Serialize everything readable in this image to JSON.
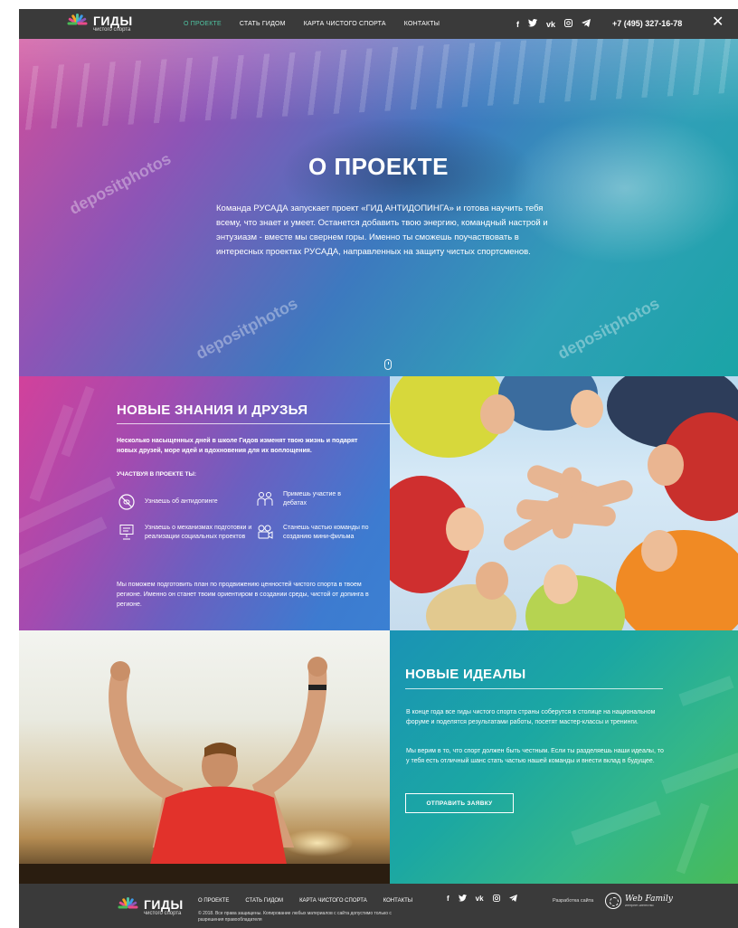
{
  "header": {
    "logo_title": "ГИДЫ",
    "logo_sub": "чистого спорта",
    "nav": [
      "О ПРОЕКТЕ",
      "СТАТЬ ГИДОМ",
      "КАРТА ЧИСТОГО СПОРТА",
      "КОНТАКТЫ"
    ],
    "social_icons": [
      "facebook-icon",
      "twitter-icon",
      "vk-icon",
      "instagram-icon",
      "telegram-icon"
    ],
    "phone": "+7 (495) 327-16-78",
    "close_glyph": "✕",
    "active_color": "#4fc3a1"
  },
  "hero": {
    "title": "О ПРОЕКТЕ",
    "text": "Команда РУСАДА запускает проект «ГИД АНТИДОПИНГА» и готова научить тебя всему, что знает и умеет. Останется добавить твою энергию, командный настрой и энтузиазм - вместе мы свернем горы. Именно ты сможешь поучаствовать в интересных проектах РУСАДА, направленных на защиту чистых спортсменов.",
    "watermark": "depositphotos"
  },
  "section_knowledge": {
    "title": "НОВЫЕ ЗНАНИЯ И ДРУЗЬЯ",
    "lead": "Несколько насыщенных дней в школе Гидов изменят твою жизнь и подарят новых друзей, море идей и вдохновения для их воплощения.",
    "subheading": "УЧАСТВУЯ В ПРОЕКТЕ ТЫ:",
    "features": [
      {
        "icon": "no-drugs-icon",
        "text": "Узнаешь об антидопинге"
      },
      {
        "icon": "debate-icon",
        "text": "Примешь участие в дебатах"
      },
      {
        "icon": "presentation-icon",
        "text": "Узнаешь о механизмах подготовки и реализации социальных проектов"
      },
      {
        "icon": "film-team-icon",
        "text": "Станешь частью команды по созданию мини-фильма"
      }
    ],
    "footer_text": "Мы поможем подготовить план по продвижению ценностей чистого спорта в твоем регионе. Именно он станет твоим ориентиром в создании среды, чистой от допинга в регионе."
  },
  "section_ideals": {
    "title": "НОВЫЕ ИДЕАЛЫ",
    "p1": "В конце года все гиды чистого спорта страны соберутся в столице на национальном форуме и поделятся результатами работы, посетят мастер-классы и тренинги.",
    "p2": "Мы верим в то, что спорт должен быть честным. Если ты разделяешь наши идеалы, то у тебя есть отличный шанс стать частью нашей команды и внести вклад в будущее.",
    "button": "ОТПРАВИТЬ ЗАЯВКУ"
  },
  "footer": {
    "logo_title": "ГИДЫ",
    "logo_sub": "чистого спорта",
    "nav": [
      "О ПРОЕКТЕ",
      "СТАТЬ ГИДОМ",
      "КАРТА ЧИСТОГО СПОРТА",
      "КОНТАКТЫ"
    ],
    "copyright": "© 2018. Все права защищены. Копирование любых материалов с сайта допустимо только с разрешения правообладателя",
    "developer_label": "Разработка сайта",
    "developer_name": "Web Family",
    "developer_sub": "интернет-агентство"
  }
}
